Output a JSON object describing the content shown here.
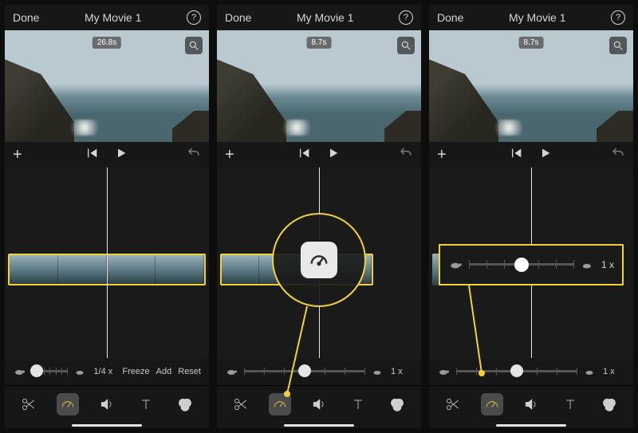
{
  "screens": {
    "s1": {
      "header": {
        "done": "Done",
        "title": "My Movie 1"
      },
      "clip_time": "26.8s",
      "speed": {
        "value_label": "1/4 x",
        "freeze": "Freeze",
        "add": "Add",
        "reset": "Reset",
        "knob_pct": 14
      }
    },
    "s2": {
      "header": {
        "done": "Done",
        "title": "My Movie 1"
      },
      "clip_time": "8.7s",
      "speed": {
        "value_label": "1 x",
        "knob_pct": 50
      }
    },
    "s3": {
      "header": {
        "done": "Done",
        "title": "My Movie 1"
      },
      "clip_time": "8.7s",
      "speed": {
        "value_label": "1 x",
        "knob_pct": 50
      },
      "callout": {
        "value_label": "1 x",
        "knob_pct": 50
      }
    }
  }
}
